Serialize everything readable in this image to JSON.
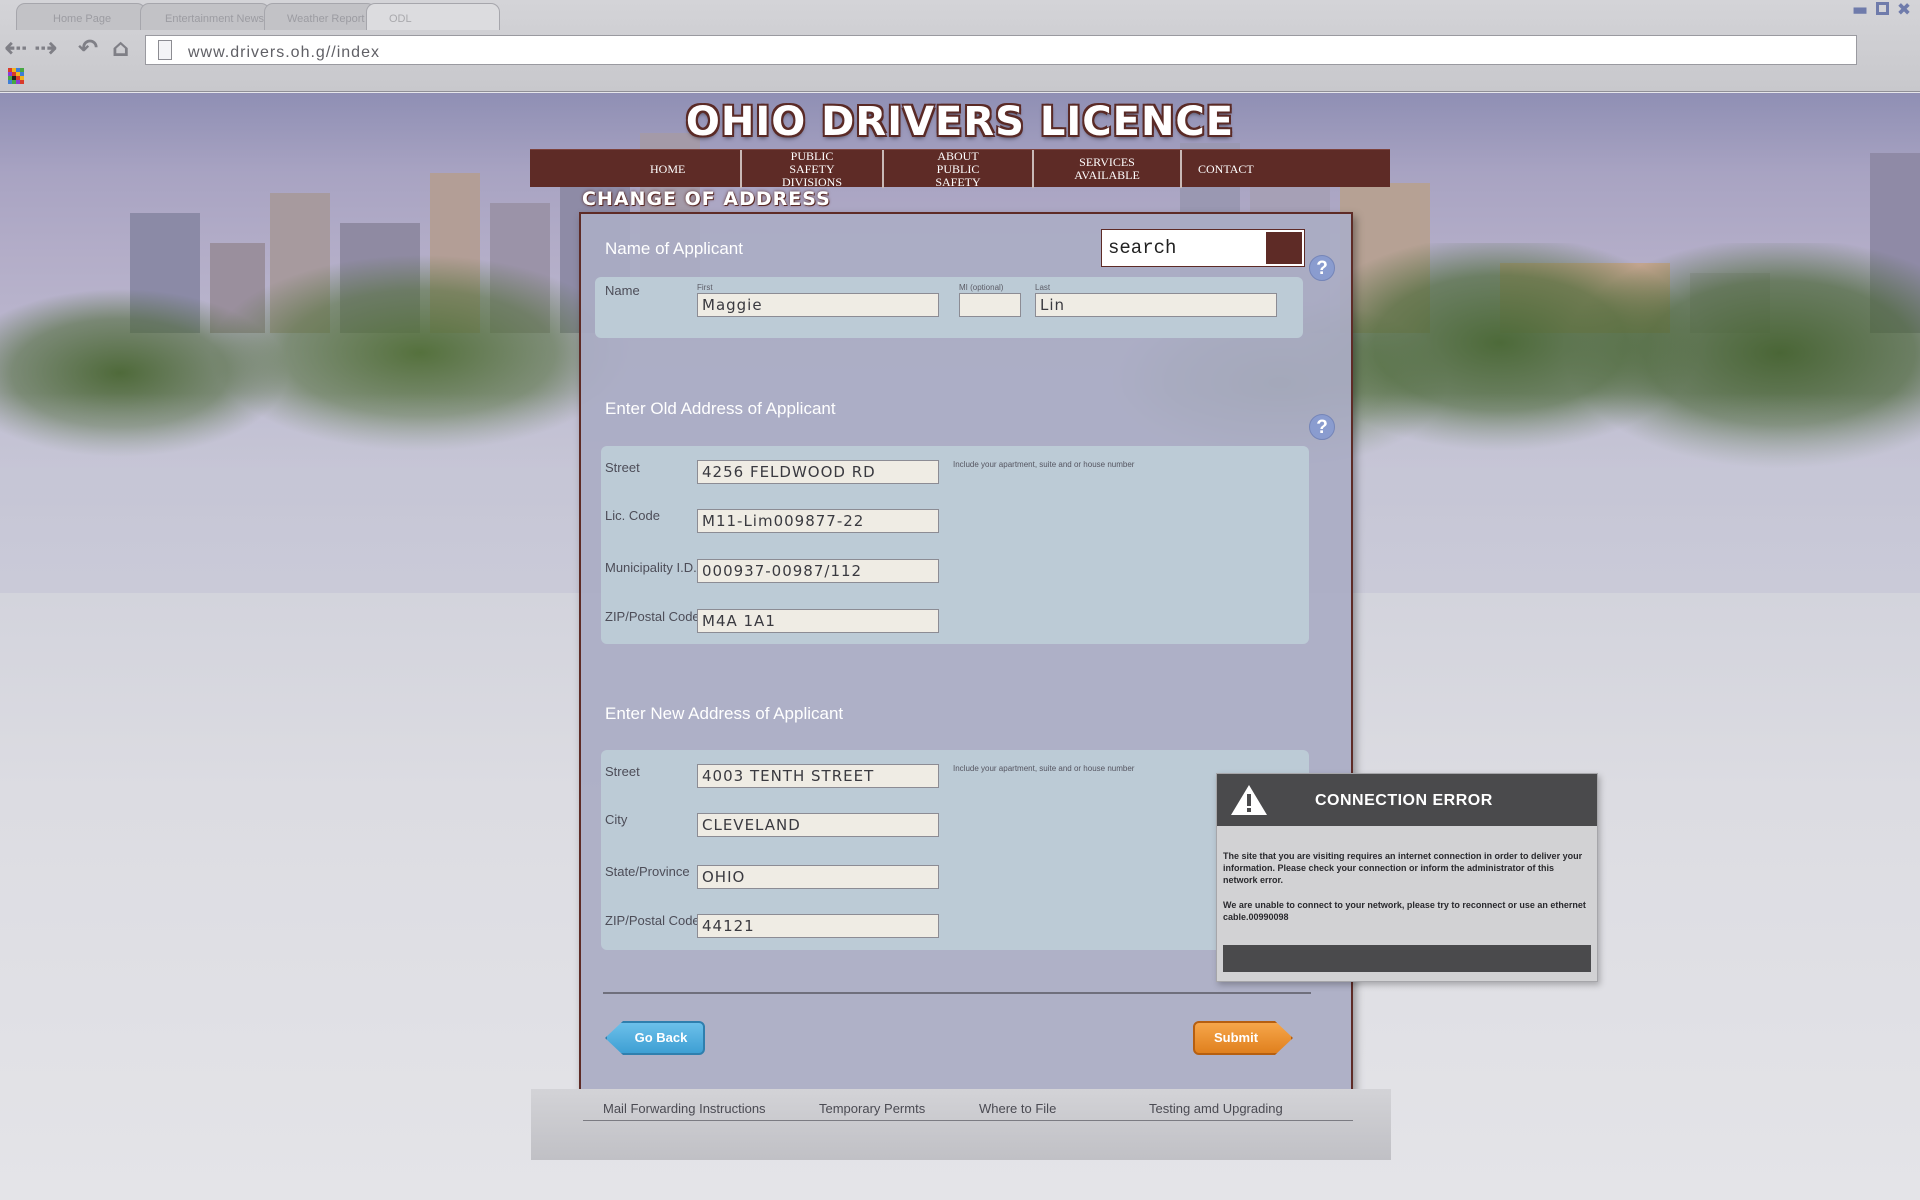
{
  "browser": {
    "tabs": [
      {
        "label": "Home Page",
        "active": false
      },
      {
        "label": "Entertainment News",
        "active": false
      },
      {
        "label": "Weather Report",
        "active": false
      },
      {
        "label": "ODL",
        "active": true
      }
    ],
    "url": "www.drivers.oh.g//index",
    "icons": [
      "back-arrow-icon",
      "forward-arrow-icon",
      "refresh-icon",
      "home-icon",
      "page-icon",
      "favicon"
    ]
  },
  "site": {
    "title": "OHIO DRIVERS LICENCE",
    "brand_color": "#5e2b26",
    "nav": [
      {
        "label": "HOME"
      },
      {
        "label": "PUBLIC SAFETY DIVISIONS"
      },
      {
        "label": "ABOUT PUBLIC SAFETY"
      },
      {
        "label": "SERVICES AVAILABLE"
      },
      {
        "label": "CONTACT"
      }
    ]
  },
  "form": {
    "heading": "CHANGE OF ADDRESS",
    "search": {
      "value": "search"
    },
    "applicant": {
      "title": "Name of Applicant",
      "name_label": "Name",
      "first_label": "First",
      "first_value": "Maggie",
      "mi_label": "MI (optional)",
      "mi_value": "",
      "last_label": "Last",
      "last_value": "Lin"
    },
    "old_address": {
      "title": "Enter Old Address of Applicant",
      "street_label": "Street",
      "street_value": "4256 FELDWOOD RD",
      "street_hint": "Include your apartment, suite and or house number",
      "lic_label": "Lic. Code",
      "lic_value": "M11-Lim009877-22",
      "muni_label": "Municipality I.D.",
      "muni_value": "000937-00987/112",
      "zip_label": "ZIP/Postal Code",
      "zip_value": "M4A 1A1"
    },
    "new_address": {
      "title": "Enter New Address of Applicant",
      "street_label": "Street",
      "street_value": "4003 TENTH STREET",
      "street_hint": "Include your apartment, suite and or house number",
      "city_label": "City",
      "city_value": "CLEVELAND",
      "state_label": "State/Province",
      "state_value": "OHIO",
      "zip_label": "ZIP/Postal Code",
      "zip_value": "44121"
    },
    "back_label": "Go Back",
    "submit_label": "Submit",
    "back_color": "#4eaede",
    "submit_color": "#ee8e2e"
  },
  "error": {
    "title": "CONNECTION ERROR",
    "message1": "The site that you are visiting requires an internet connection in order to deliver your information. Please check your connection or inform the administrator of this network error.",
    "message2": "We are unable to connect to your network, please try to reconnect or use an ethernet cable.00990098"
  },
  "footer": {
    "links": [
      "Mail Forwarding Instructions",
      "Temporary Permts",
      "Where to File",
      "Testing amd Upgrading"
    ]
  }
}
